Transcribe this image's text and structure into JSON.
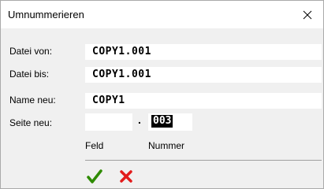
{
  "window": {
    "title": "Umnummerieren",
    "close_icon": "close-icon"
  },
  "form": {
    "datei_von": {
      "label": "Datei von:",
      "value": "COPY1.001"
    },
    "datei_bis": {
      "label": "Datei bis:",
      "value": "COPY1.001"
    },
    "name_neu": {
      "label": "Name neu:",
      "value": "COPY1"
    },
    "seite_neu": {
      "label": "Seite neu:",
      "feld_value": "",
      "separator": ".",
      "nummer_value": "003",
      "feld_caption": "Feld",
      "nummer_caption": "Nummer"
    }
  },
  "actions": {
    "ok_icon": "checkmark-icon",
    "cancel_icon": "cross-icon",
    "ok_color": "#2e8b00",
    "cancel_color": "#e21b1b"
  }
}
